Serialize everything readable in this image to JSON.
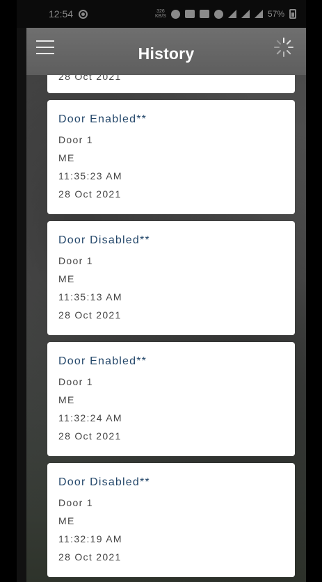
{
  "status_bar": {
    "time": "12:54",
    "net_speed_value": "326",
    "net_speed_unit": "KB/S",
    "battery": "57%"
  },
  "app_bar": {
    "title": "History"
  },
  "partial_entry": {
    "date": "28 Oct 2021"
  },
  "entries": [
    {
      "event": "Door Enabled**",
      "door": "Door 1",
      "user": "ME",
      "time": "11:35:23 AM",
      "date": "28 Oct 2021"
    },
    {
      "event": "Door Disabled**",
      "door": "Door 1",
      "user": "ME",
      "time": "11:35:13 AM",
      "date": "28 Oct 2021"
    },
    {
      "event": "Door Enabled**",
      "door": "Door 1",
      "user": "ME",
      "time": "11:32:24 AM",
      "date": "28 Oct 2021"
    },
    {
      "event": "Door Disabled**",
      "door": "Door 1",
      "user": "ME",
      "time": "11:32:19 AM",
      "date": "28 Oct 2021"
    }
  ],
  "icons": {
    "menu": "hamburger-menu-icon",
    "loading": "loading-spinner-icon"
  }
}
